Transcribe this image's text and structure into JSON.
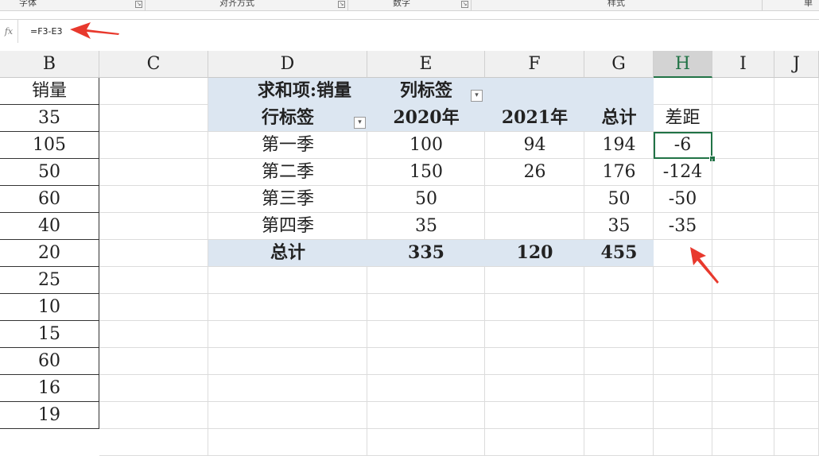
{
  "ribbon": {
    "groups": [
      "字体",
      "对齐方式",
      "数字",
      "样式",
      "单元"
    ]
  },
  "formula_bar": {
    "fx_icon": "fx-icon",
    "formula": "=F3-E3"
  },
  "columns": [
    "B",
    "C",
    "D",
    "E",
    "F",
    "G",
    "H",
    "I",
    "J"
  ],
  "selected_column": "H",
  "column_b": {
    "header": "销量",
    "values": [
      "35",
      "105",
      "50",
      "60",
      "40",
      "20",
      "25",
      "10",
      "15",
      "60",
      "16",
      "19"
    ]
  },
  "pivot": {
    "title": "求和项:销量",
    "col_label": "列标签",
    "row_label": "行标签",
    "col_headers": [
      "2020年",
      "2021年",
      "总计"
    ],
    "rows": [
      {
        "label": "第一季",
        "values": [
          "100",
          "94",
          "194"
        ]
      },
      {
        "label": "第二季",
        "values": [
          "150",
          "26",
          "176"
        ]
      },
      {
        "label": "第三季",
        "values": [
          "50",
          "",
          "50"
        ]
      },
      {
        "label": "第四季",
        "values": [
          "35",
          "",
          "35"
        ]
      }
    ],
    "total": {
      "label": "总计",
      "values": [
        "335",
        "120",
        "455"
      ]
    }
  },
  "column_h": {
    "header": "差距",
    "values": [
      "-6",
      "-124",
      "-50",
      "-35"
    ]
  },
  "colors": {
    "pivot_fill": "#dce6f1",
    "selection": "#217346",
    "arrow": "#e8392d"
  }
}
